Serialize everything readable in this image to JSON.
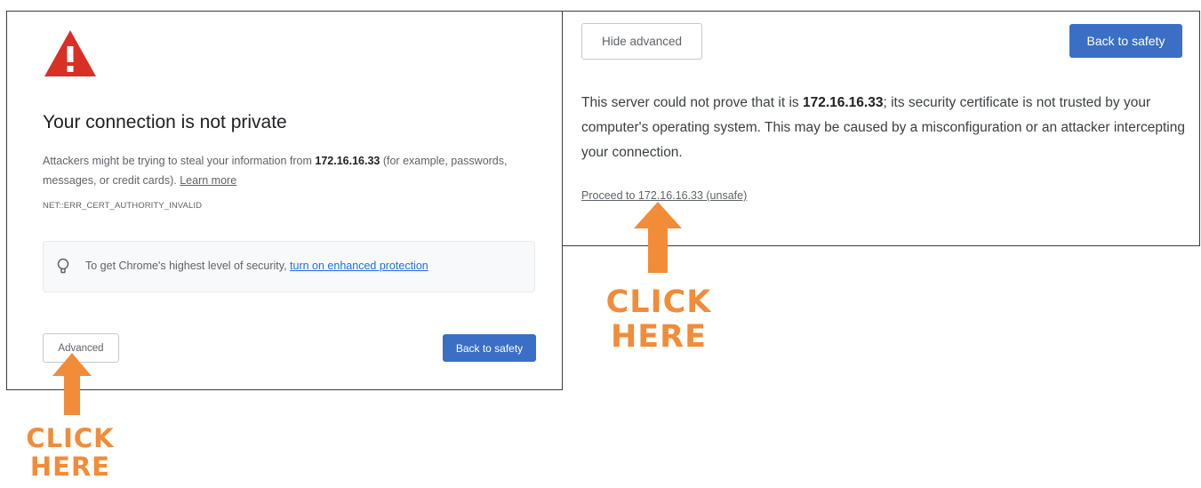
{
  "left_panel": {
    "title": "Your connection is not private",
    "body_prefix": "Attackers might be trying to steal your information from ",
    "host": "172.16.16.33",
    "body_suffix": " (for example, passwords, messages, or credit cards). ",
    "learn_more": "Learn more",
    "error_code": "NET::ERR_CERT_AUTHORITY_INVALID",
    "tip_text": "To get Chrome's highest level of security, ",
    "tip_link": "turn on enhanced protection",
    "advanced_button": "Advanced",
    "back_button": "Back to safety",
    "icons": {
      "warning": "warning-triangle-icon",
      "tip": "lightbulb-icon"
    }
  },
  "right_panel": {
    "hide_button": "Hide advanced",
    "back_button": "Back to safety",
    "body_prefix": "This server could not prove that it is ",
    "host": "172.16.16.33",
    "body_suffix": "; its security certificate is not trusted by your computer's operating system. This may be caused by a misconfiguration or an attacker intercepting your connection.",
    "proceed_link": "Proceed to 172.16.16.33 (unsafe)"
  },
  "annotations": {
    "left": {
      "line1": "CLICK",
      "line2": "HERE"
    },
    "right": {
      "line1": "CLICK",
      "line2": "HERE"
    },
    "color": "#f28c38"
  },
  "colors": {
    "primary_button": "#3b6fc6",
    "warning_red": "#d93025",
    "link_blue": "#1a73e8"
  }
}
